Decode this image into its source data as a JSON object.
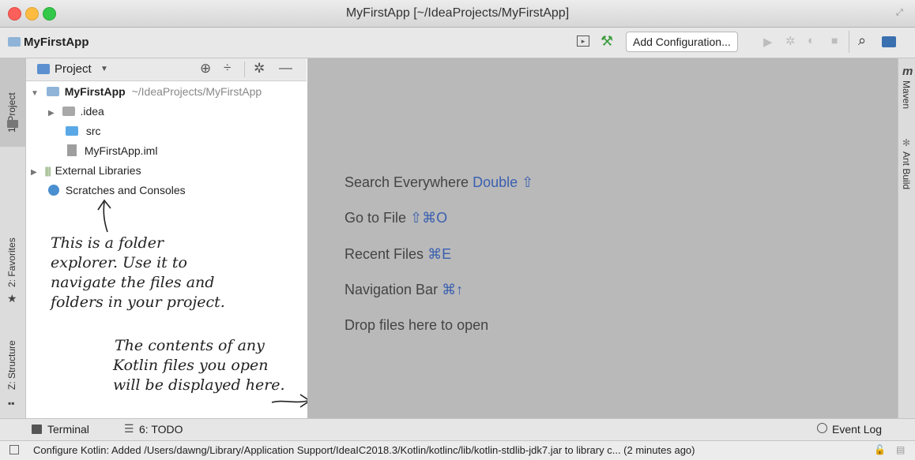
{
  "window": {
    "title": "MyFirstApp [~/IdeaProjects/MyFirstApp]"
  },
  "navbar": {
    "project_name": "MyFirstApp",
    "add_config_label": "Add Configuration..."
  },
  "left_tool_tabs": {
    "project": "1: Project",
    "favorites": "2: Favorites",
    "structure": "Z: Structure"
  },
  "right_tool_tabs": {
    "maven": "Maven",
    "ant": "Ant Build"
  },
  "project_panel": {
    "view_selector": "Project",
    "tree": {
      "root_name": "MyFirstApp",
      "root_path": "~/IdeaProjects/MyFirstApp",
      "idea": ".idea",
      "src": "src",
      "iml": "MyFirstApp.iml",
      "external_libs": "External Libraries",
      "scratches": "Scratches and Consoles"
    }
  },
  "editor": {
    "tips": [
      {
        "label": "Search Everywhere",
        "key": "Double ⇧"
      },
      {
        "label": "Go to File",
        "key": "⇧⌘O"
      },
      {
        "label": "Recent Files",
        "key": "⌘E"
      },
      {
        "label": "Navigation Bar",
        "key": "⌘↑"
      },
      {
        "label": "Drop files here to open",
        "key": ""
      }
    ]
  },
  "annotations": {
    "folder_explorer": [
      "This is a folder",
      "explorer. Use it to",
      "navigate the files and",
      "folders in your project."
    ],
    "kotlin_files": [
      "The contents of any",
      "Kotlin files you open",
      "will be displayed here."
    ]
  },
  "bottom_tabs": {
    "terminal": "Terminal",
    "todo": "6: TODO",
    "event_log": "Event Log"
  },
  "status": {
    "message": "Configure Kotlin: Added /Users/dawng/Library/Application Support/IdeaIC2018.3/Kotlin/kotlinc/lib/kotlin-stdlib-jdk7.jar to library c... (2 minutes ago)"
  },
  "colors": {
    "editor_bg": "#b9b9b9",
    "shortcut_blue": "#3a5fb0",
    "close_red": "#fc605b",
    "min_yellow": "#fdbc40",
    "max_green": "#34c84a"
  }
}
